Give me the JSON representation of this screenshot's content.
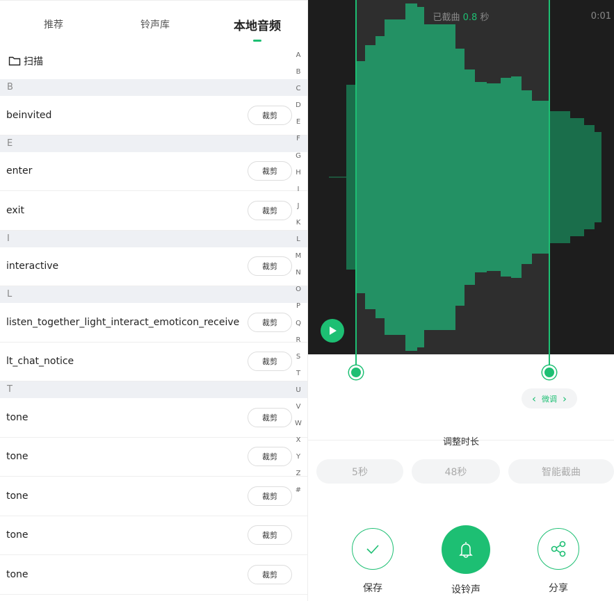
{
  "tabs": [
    {
      "label": "推荐"
    },
    {
      "label": "铃声库"
    },
    {
      "label": "本地音频",
      "active": true
    }
  ],
  "scan_label": "扫描",
  "list": [
    {
      "section": "B",
      "items": [
        "beinvited"
      ]
    },
    {
      "section": "E",
      "items": [
        "enter",
        "exit"
      ]
    },
    {
      "section": "I",
      "items": [
        "interactive"
      ]
    },
    {
      "section": "L",
      "items": [
        "listen_together_light_interact_emoticon_receive",
        "lt_chat_notice"
      ]
    },
    {
      "section": "T",
      "items": [
        "tone",
        "tone",
        "tone",
        "tone",
        "tone"
      ]
    }
  ],
  "cut_label": "裁剪",
  "index_letters": [
    "A",
    "B",
    "C",
    "D",
    "E",
    "F",
    "G",
    "H",
    "I",
    "J",
    "K",
    "L",
    "M",
    "N",
    "O",
    "P",
    "Q",
    "R",
    "S",
    "T",
    "U",
    "V",
    "W",
    "X",
    "Y",
    "Z",
    "#"
  ],
  "editor": {
    "clipped_prefix": "已截曲",
    "clipped_value": "0.8",
    "clipped_unit": "秒",
    "time": "0:01",
    "fine_tune_label": "微调",
    "adjust_label": "调整时长",
    "durations": [
      "5秒",
      "48秒",
      "智能截曲"
    ],
    "actions": [
      {
        "label": "保存",
        "icon": "check-icon"
      },
      {
        "label": "设铃声",
        "icon": "bell-icon"
      },
      {
        "label": "分享",
        "icon": "share-icon"
      }
    ]
  },
  "colors": {
    "accent": "#1dbf73",
    "waveform": "#1f8a5c"
  }
}
